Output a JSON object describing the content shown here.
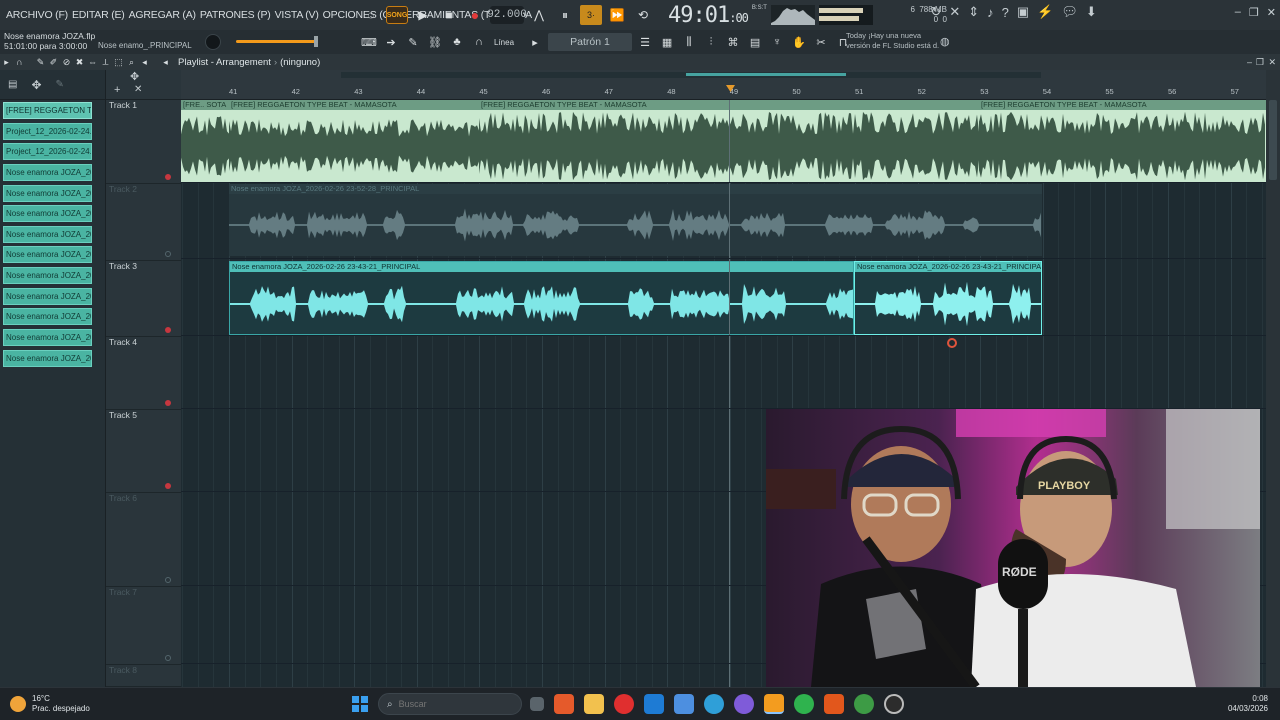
{
  "menu": [
    "ARCHIVO (F)",
    "EDITAR (E)",
    "AGREGAR (A)",
    "PATRONES (P)",
    "VISTA (V)",
    "OPCIONES (O)",
    "HERRAMIENTAS (T)",
    "AYUDA"
  ],
  "transport": {
    "song_mode": "SONG",
    "tempo": "92.000",
    "time_main": "49:01",
    "time_sub": ":00",
    "time_unit": "B:S:T",
    "cpu_voices": "6",
    "cpu_polyphony": "0",
    "memory": "788 MB",
    "memory_voices": "0"
  },
  "hint": {
    "project_file": "Nose enamora JOZA.flp",
    "position": "51:01:00 para 3:00:00",
    "channel_name": "Nose enamo_.PRINCIPAL",
    "snap": "Línea",
    "pattern": "Patrón 1",
    "news_line1": "Today ¡Hay una nueva",
    "news_line2": "versión de FL Studio está d."
  },
  "playlist": {
    "title": "Playlist - Arrangement",
    "arrangement": "(ninguno)",
    "bars": [
      "41",
      "42",
      "43",
      "44",
      "45",
      "46",
      "47",
      "48",
      "49",
      "50",
      "51",
      "52",
      "53",
      "54",
      "55",
      "56",
      "57"
    ]
  },
  "clip_list": [
    "[FREE] REGGAETON T..",
    "Project_12_2026-02-24..",
    "Project_12_2026-02-24..",
    "Nose enamora JOZA_202..",
    "Nose enamora JOZA_202..",
    "Nose enamora JOZA_202..",
    "Nose enamora JOZA_202..",
    "Nose enamora JOZA_202..",
    "Nose enamora JOZA_202..",
    "Nose enamora JOZA_202..",
    "Nose enamora JOZA_202..",
    "Nose enamora JOZA_202..",
    "Nose enamora JOZA_202.."
  ],
  "tracks": [
    {
      "name": "Track 1",
      "active": true
    },
    {
      "name": "Track 2",
      "active": false
    },
    {
      "name": "Track 3",
      "active": true
    },
    {
      "name": "Track 4",
      "active": true
    },
    {
      "name": "Track 5",
      "active": true
    },
    {
      "name": "Track 6",
      "active": false
    },
    {
      "name": "Track 7",
      "active": false
    },
    {
      "name": "Track 8",
      "active": false
    }
  ],
  "clips": {
    "beat_a": "[FRE.. SOTA",
    "beat_b": "[FREE] REGGAETON TYPE BEAT - MAMASOTA",
    "beat_c": "[FREE] REGGAETON TYPE BEAT - MAMASOTA",
    "beat_d": "[FREE] REGGAETON TYPE BEAT - MAMASOTA",
    "vocal_ghost": "Nose enamora JOZA_2026-02-26 23-52-28_PRINCIPAL",
    "vocal_main": "Nose enamora JOZA_2026-02-26 23-43-21_PRINCIPAL",
    "vocal_selected": "Nose enamora JOZA_2026-02-26 23-43-21_PRINCIPAL"
  },
  "webcam": {
    "mic_brand": "RØDE",
    "cap_text": "PLAYBOY"
  },
  "taskbar": {
    "temperature": "16°C",
    "weather": "Prac. despejado",
    "search_placeholder": "Buscar",
    "time": "0:08",
    "date": "04/03/2026"
  },
  "colors": {
    "beat_clip": "#c9e8cf",
    "vocal_clip": "#4fbfb8",
    "transport_accent": "#f4a51c",
    "record": "#e23b3b"
  }
}
